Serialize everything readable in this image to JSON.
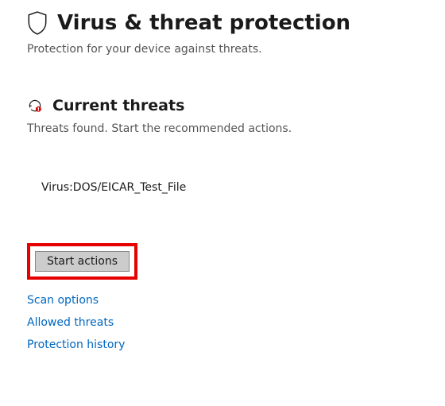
{
  "header": {
    "title": "Virus & threat protection",
    "subtitle": "Protection for your device against threats."
  },
  "section": {
    "title": "Current threats",
    "subtitle": "Threats found. Start the recommended actions."
  },
  "threats": [
    {
      "name": "Virus:DOS/EICAR_Test_File"
    }
  ],
  "actions": {
    "start_label": "Start actions"
  },
  "links": {
    "scan_options": "Scan options",
    "allowed_threats": "Allowed threats",
    "protection_history": "Protection history"
  },
  "colors": {
    "accent_link": "#0067c0",
    "highlight_border": "#e60000"
  }
}
